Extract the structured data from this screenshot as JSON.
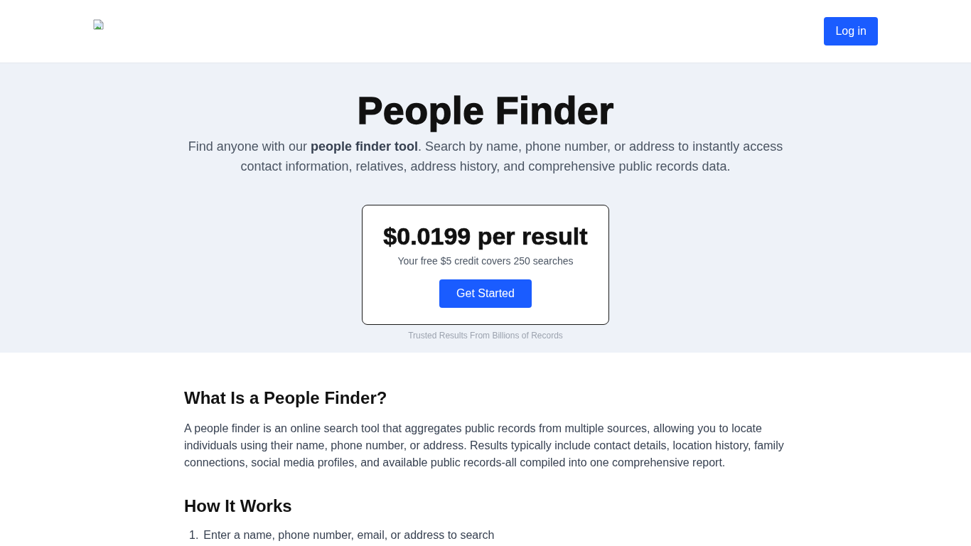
{
  "header": {
    "login_button": "Log in"
  },
  "hero": {
    "title": "People Finder",
    "intro": "Find anyone with our **people finder tool**. Search by name, phone number, or address to instantly access contact information, relatives, address history, and comprehensive public records data.",
    "pricing_card": {
      "price": "$0.0199 per result",
      "note": "Your free $5 credit covers 250 searches",
      "button": "Get Started"
    },
    "caption": "Trusted Results From Billions of Records"
  },
  "sections": [
    {
      "kind": "text",
      "heading": "What Is a People Finder?",
      "text": "A people finder is an online search tool that aggregates public records from multiple sources, allowing you to locate individuals using their name, phone number, or address. Results typically include contact details, location history, family connections, social media profiles, and available public records-all compiled into one comprehensive report."
    },
    {
      "kind": "steps",
      "heading": "How It Works",
      "steps": [
        {
          "number": "1.",
          "text": "Enter a name, phone number, email, or address to search"
        }
      ]
    }
  ]
}
